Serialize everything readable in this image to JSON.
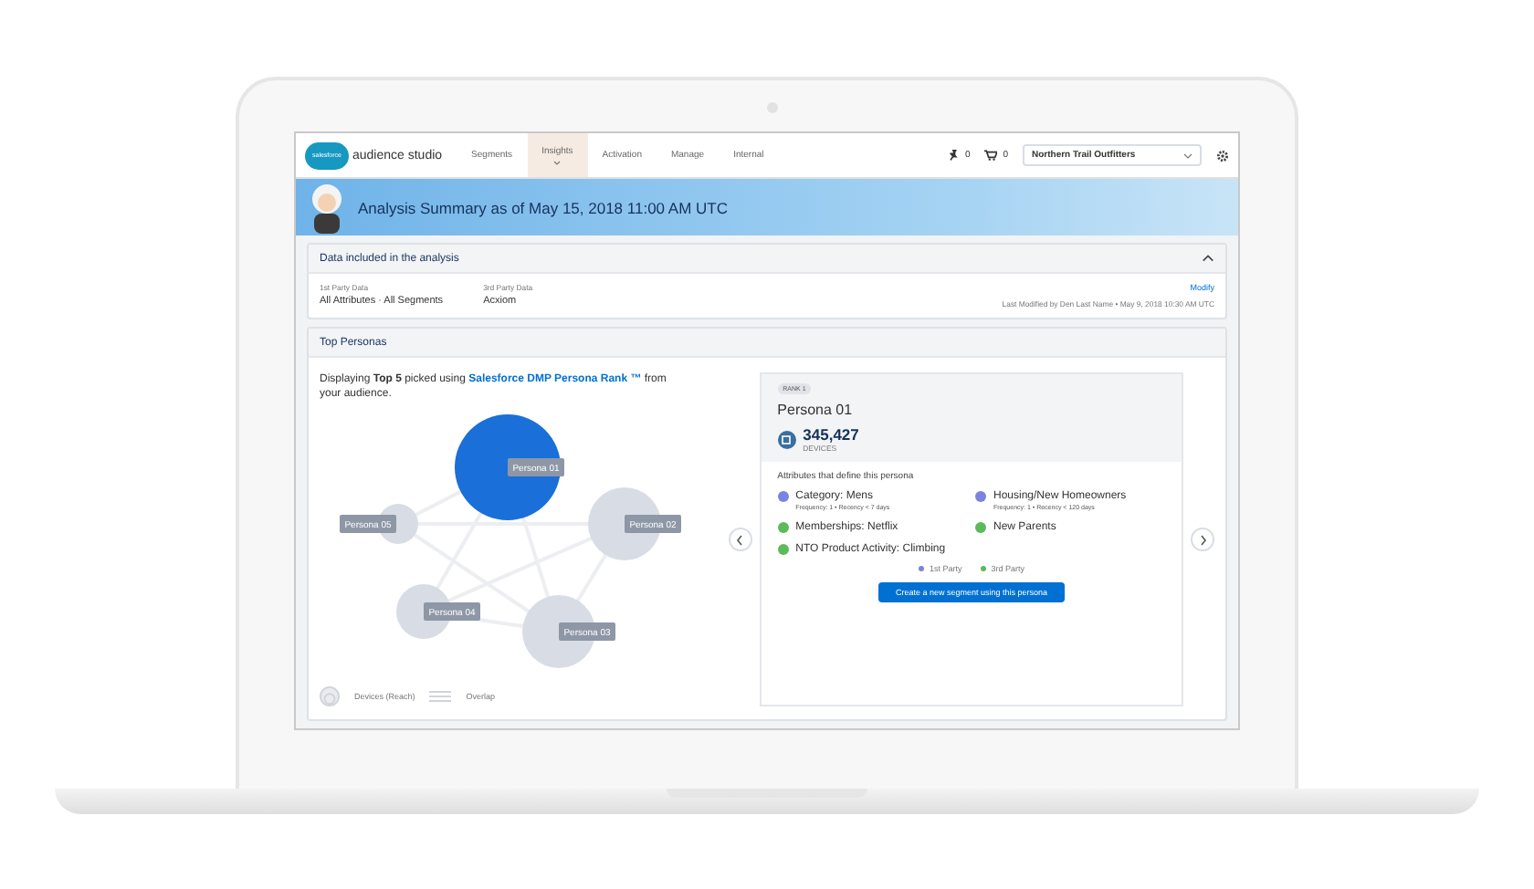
{
  "nav": {
    "logo_text": "salesforce",
    "product": "audience studio",
    "tabs": [
      {
        "label": "Segments",
        "selected": false
      },
      {
        "label": "Insights",
        "selected": true
      },
      {
        "label": "Activation",
        "selected": false
      },
      {
        "label": "Manage",
        "selected": false
      },
      {
        "label": "Internal",
        "selected": false
      }
    ],
    "pins": "0",
    "cart": "0",
    "org": "Northern Trail Outfitters"
  },
  "banner": {
    "title": "Analysis Summary as of May 15, 2018 11:00 AM UTC"
  },
  "data_card": {
    "title": "Data included in the analysis",
    "expanded": true,
    "fields": [
      {
        "label": "1st Party Data",
        "value": "All Attributes · All Segments"
      },
      {
        "label": "3rd Party Data",
        "value": "Acxiom"
      }
    ],
    "modify": "Modify",
    "last_modified": "Last Modified by Den Last Name • May 9, 2018 10:30 AM UTC"
  },
  "top_personas": {
    "title": "Top Personas",
    "intro_before": "Displaying **Top 5** picked using ",
    "intro_link": "Salesforce DMP Persona Rank ™",
    "intro_after": " from your audience.",
    "nodes": [
      {
        "label": "Persona 01",
        "selected": true
      },
      {
        "label": "Persona 05",
        "selected": false
      },
      {
        "label": "Persona 02",
        "selected": false
      },
      {
        "label": "Persona 04",
        "selected": false
      },
      {
        "label": "Persona 03",
        "selected": false
      }
    ],
    "legend": [
      "Devices (Reach)",
      "Overlap"
    ],
    "persona": {
      "rank": "RANK 1",
      "name": "Persona 01",
      "count": "345,427",
      "count_label": "DEVICES",
      "attributes_title": "Attributes that define this persona",
      "attributes": [
        {
          "name": "Category: Mens",
          "detail": "Frequency: 1  • Recency < 7 days",
          "color": "#7b83e0"
        },
        {
          "name": "Housing/New Homeowners",
          "detail": "Frequency: 1  • Recency < 120 days",
          "color": "#7b83e0"
        },
        {
          "name": "Memberships: Netflix",
          "color": "#5cba5c"
        },
        {
          "name": "New Parents",
          "color": "#5cba5c"
        },
        {
          "name": "NTO Product Activity: Climbing",
          "color": "#5cba5c"
        }
      ],
      "sources": [
        {
          "label": "1st Party",
          "color": "#7b83e0"
        },
        {
          "label": "3rd Party",
          "color": "#5cba5c"
        }
      ],
      "button": "Create a new segment using this persona"
    }
  }
}
